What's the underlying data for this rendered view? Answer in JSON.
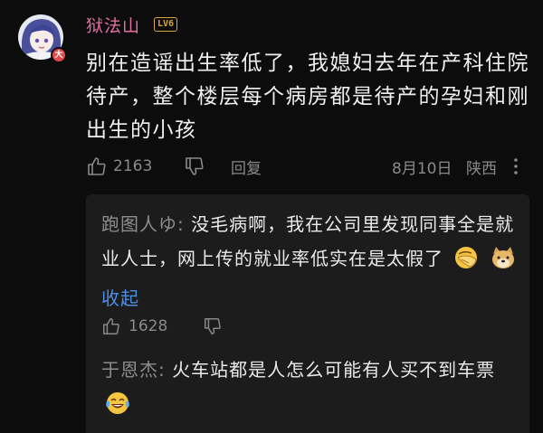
{
  "comment": {
    "username": "狱法山",
    "level_badge": "LV6",
    "avatar_badge": "大",
    "text": "别在造谣出生率低了，我媳妇去年在产科住院待产，整个楼层每个病房都是待产的孕妇和刚出生的小孩",
    "likes": "2163",
    "reply_label": "回复",
    "date": "8月10日",
    "location": "陕西",
    "colors": {
      "username": "#e36fa0",
      "level_badge": "#d9a63a"
    }
  },
  "replies": [
    {
      "author": "跑图人ゆ:",
      "text": " 没毛病啊，我在公司里发现同事全是就业人士，网上传的就业率低实在是太假了",
      "emojis": [
        "facepalm-emoji",
        "doge-emoji"
      ],
      "collapse_label": "收起",
      "likes": "1628"
    },
    {
      "author": "于恩杰:",
      "text": " 火车站都是人怎么可能有人买不到车票",
      "emojis": [
        "laughing-tears-emoji"
      ]
    }
  ],
  "colors": {
    "link": "#4d8ee6",
    "muted": "#8a8a8a",
    "reply_bg": "#1c1c1c"
  }
}
